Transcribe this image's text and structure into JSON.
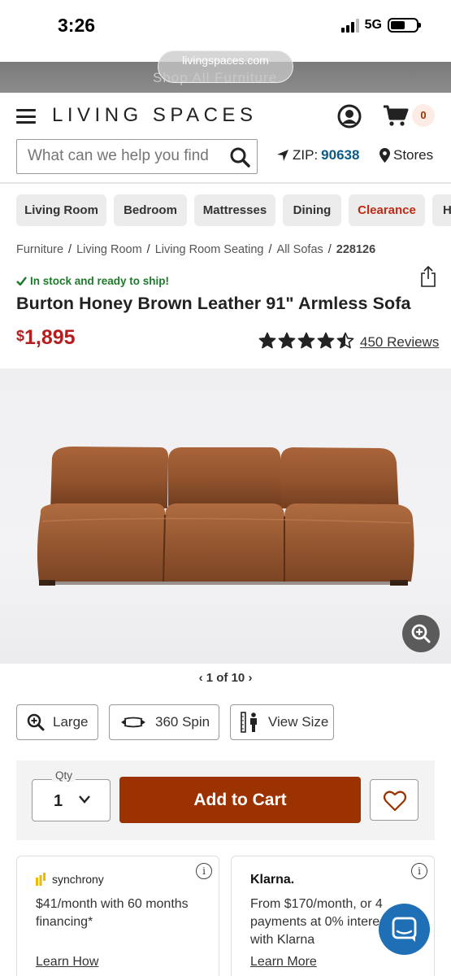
{
  "status_bar": {
    "time": "3:26",
    "network": "5G"
  },
  "browser": {
    "url": "livingspaces.com",
    "banner_text": "Shop All Furniture"
  },
  "header": {
    "logo": "LIVING SPACES",
    "cart_count": "0"
  },
  "search": {
    "placeholder": "What can we help you find",
    "zip_label": "ZIP:",
    "zip_value": "90638",
    "stores_label": "Stores"
  },
  "categories": [
    "Living Room",
    "Bedroom",
    "Mattresses",
    "Dining",
    "Clearance",
    "H"
  ],
  "breadcrumb": [
    "Furniture",
    "Living Room",
    "Living Room Seating",
    "All Sofas",
    "228126"
  ],
  "product": {
    "stock_text": "In stock and ready to ship!",
    "title": "Burton Honey Brown Leather 91\" Armless Sofa",
    "price_currency": "$",
    "price_amount": "1,895",
    "rating": 4.5,
    "reviews": "450 Reviews"
  },
  "gallery": {
    "position": "1 of 10"
  },
  "view_options": {
    "large": "Large",
    "spin": "360 Spin",
    "size": "View Size"
  },
  "cart": {
    "qty_label": "Qty",
    "qty_value": "1",
    "add_label": "Add to Cart"
  },
  "financing": {
    "synchrony": {
      "brand": "synchrony",
      "text": "$41/month with 60 months financing*",
      "link": "Learn How"
    },
    "klarna": {
      "brand": "Klarna.",
      "text": "From $170/month, or 4 payments at 0% interest with Klarna",
      "link": "Learn More"
    }
  },
  "colors": {
    "brand_button": "#9b3200",
    "price": "#b51e1e",
    "stock": "#1d7a2a",
    "zip": "#0a5b87",
    "clearance": "#c02a15"
  }
}
